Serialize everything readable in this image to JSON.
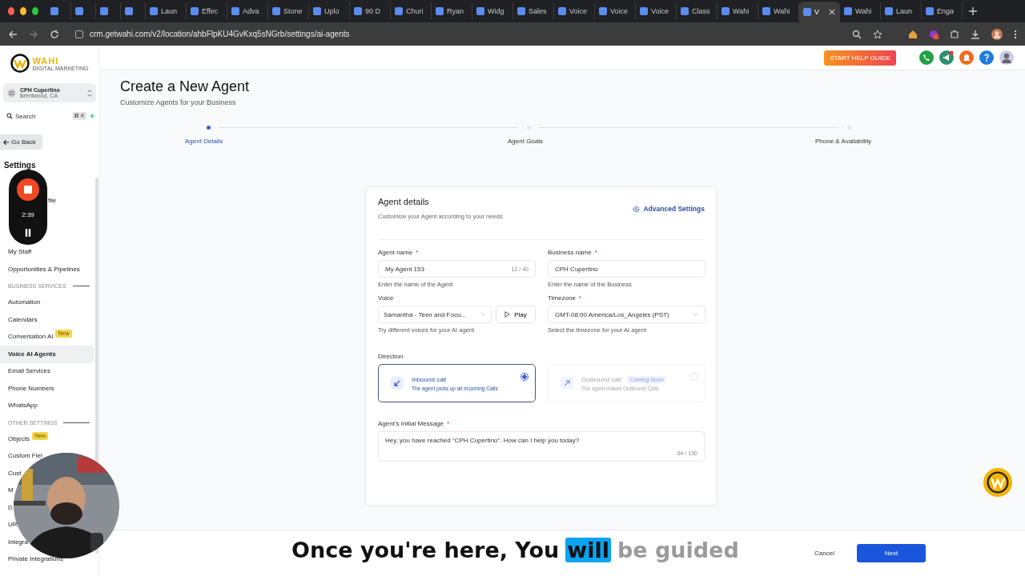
{
  "browser": {
    "tabs": [
      {
        "selected": false
      },
      {
        "selected": false
      },
      {
        "selected": false
      },
      {
        "selected": false
      },
      {
        "label": "Laun",
        "selected": false
      },
      {
        "label": "Effec",
        "selected": false
      },
      {
        "label": "Adva",
        "selected": false
      },
      {
        "label": "Stone",
        "selected": false
      },
      {
        "label": "Uplo",
        "selected": false
      },
      {
        "label": "90 D",
        "selected": false
      },
      {
        "label": "Churi",
        "selected": false
      },
      {
        "label": "Ryan",
        "selected": false
      },
      {
        "label": "Widg",
        "selected": false
      },
      {
        "label": "Sales",
        "selected": false
      },
      {
        "label": "Voice",
        "selected": false
      },
      {
        "label": "Voice",
        "selected": false
      },
      {
        "label": "Voice",
        "selected": false
      },
      {
        "label": "Class",
        "selected": false
      },
      {
        "label": "Wahi",
        "selected": false
      },
      {
        "label": "Wahi",
        "selected": false
      },
      {
        "label": "V",
        "selected": true
      },
      {
        "label": "Wahi",
        "selected": false
      },
      {
        "label": "Laun",
        "selected": false
      },
      {
        "label": "Enga",
        "selected": false
      }
    ],
    "url": "crm.getwahi.com/v2/location/ahbFlpKU4GvKxq5sNGrb/settings/ai-agents"
  },
  "sidebar": {
    "logo": "WAHI",
    "logo_tagline": "DIGITAL MARKETING",
    "location": {
      "name": "CPH Cupertino",
      "place": "Brentwood, CA"
    },
    "search": {
      "placeholder": "Search",
      "shortcut": "⌘ K"
    },
    "back": "Go Back",
    "heading": "Settings",
    "items": [
      {
        "kind": "item",
        "label": "file",
        "selected": false
      },
      {
        "kind": "item",
        "label": "My Staff",
        "selected": false
      },
      {
        "kind": "item",
        "label": "Opportunities & Pipelines",
        "selected": false
      },
      {
        "kind": "section",
        "label": "BUSINESS SERVICES"
      },
      {
        "kind": "item",
        "label": "Automation",
        "selected": false
      },
      {
        "kind": "item",
        "label": "Calendars",
        "selected": false
      },
      {
        "kind": "item",
        "label": "Conversation AI",
        "badge": "New",
        "selected": false
      },
      {
        "kind": "item",
        "label": "Voice AI Agents",
        "selected": true
      },
      {
        "kind": "item",
        "label": "Email Services",
        "selected": false
      },
      {
        "kind": "item",
        "label": "Phone Numbers",
        "selected": false
      },
      {
        "kind": "item",
        "label": "WhatsApp",
        "selected": false
      },
      {
        "kind": "section",
        "label": "OTHER SETTINGS"
      },
      {
        "kind": "item",
        "label": "Objects",
        "badge": "New",
        "selected": false
      },
      {
        "kind": "item",
        "label": "Custom Fiel",
        "selected": false
      },
      {
        "kind": "item",
        "label": "Cust",
        "selected": false
      },
      {
        "kind": "item",
        "label": "M",
        "selected": false
      },
      {
        "kind": "item",
        "label": "D",
        "selected": false
      },
      {
        "kind": "item",
        "label": "UR",
        "selected": false
      },
      {
        "kind": "item",
        "label": "Integra",
        "selected": false
      },
      {
        "kind": "item",
        "label": "Private Integrations",
        "selected": false
      }
    ]
  },
  "recorder": {
    "time": "2:39"
  },
  "header": {
    "help_button": "START HELP GUIDE"
  },
  "page": {
    "title": "Create a New Agent",
    "subtitle": "Customize Agents for your Business",
    "steps": [
      {
        "label": "Agent Details",
        "selected": true
      },
      {
        "label": "Agent Goals",
        "selected": false
      },
      {
        "label": "Phone & Availability",
        "selected": false
      }
    ]
  },
  "card": {
    "title": "Agent details",
    "subtitle": "Customize your Agent according to your needs",
    "advanced": "Advanced Settings",
    "agent_name": {
      "label": "Agent name",
      "required_mark": "*",
      "value": "My Agent 153",
      "counter": "12 / 40",
      "hint": "Enter the name of the Agent"
    },
    "business_name": {
      "label": "Business name",
      "required_mark": "*",
      "value": "CPH Cupertino",
      "hint": "Enter the name of the Business"
    },
    "voice": {
      "label": "Voice",
      "value": "Samantha - Teen and Focu...",
      "play": "Play",
      "hint": "Try different voices for your AI agent"
    },
    "timezone": {
      "label": "Timezone",
      "required_mark": "*",
      "value": "GMT-08:00 America/Los_Angeles (PST)",
      "hint": "Select the timezone for your AI agent"
    },
    "direction": {
      "label": "Direction",
      "options": [
        {
          "title": "Inbound call",
          "description": "The agent picks up all Incoming Calls",
          "selected": true,
          "disabled": false
        },
        {
          "title": "Outbound call",
          "badge": "Coming Soon",
          "description": "The agent makes Outbound Calls",
          "selected": false,
          "disabled": true
        }
      ]
    },
    "message": {
      "label": "Agent's Initial Message",
      "required_mark": "*",
      "value": "Hey, you have reached \"CPH Cupertino\". How can I help you today?",
      "counter": "64 / 190"
    }
  },
  "footer": {
    "cancel": "Cancel",
    "next": "Next"
  },
  "caption": [
    {
      "text": "Once you're here, You",
      "spoken": true,
      "highlighted": false
    },
    {
      "text": "will",
      "spoken": true,
      "highlighted": true
    },
    {
      "text": "be guided",
      "spoken": false,
      "highlighted": false
    }
  ]
}
